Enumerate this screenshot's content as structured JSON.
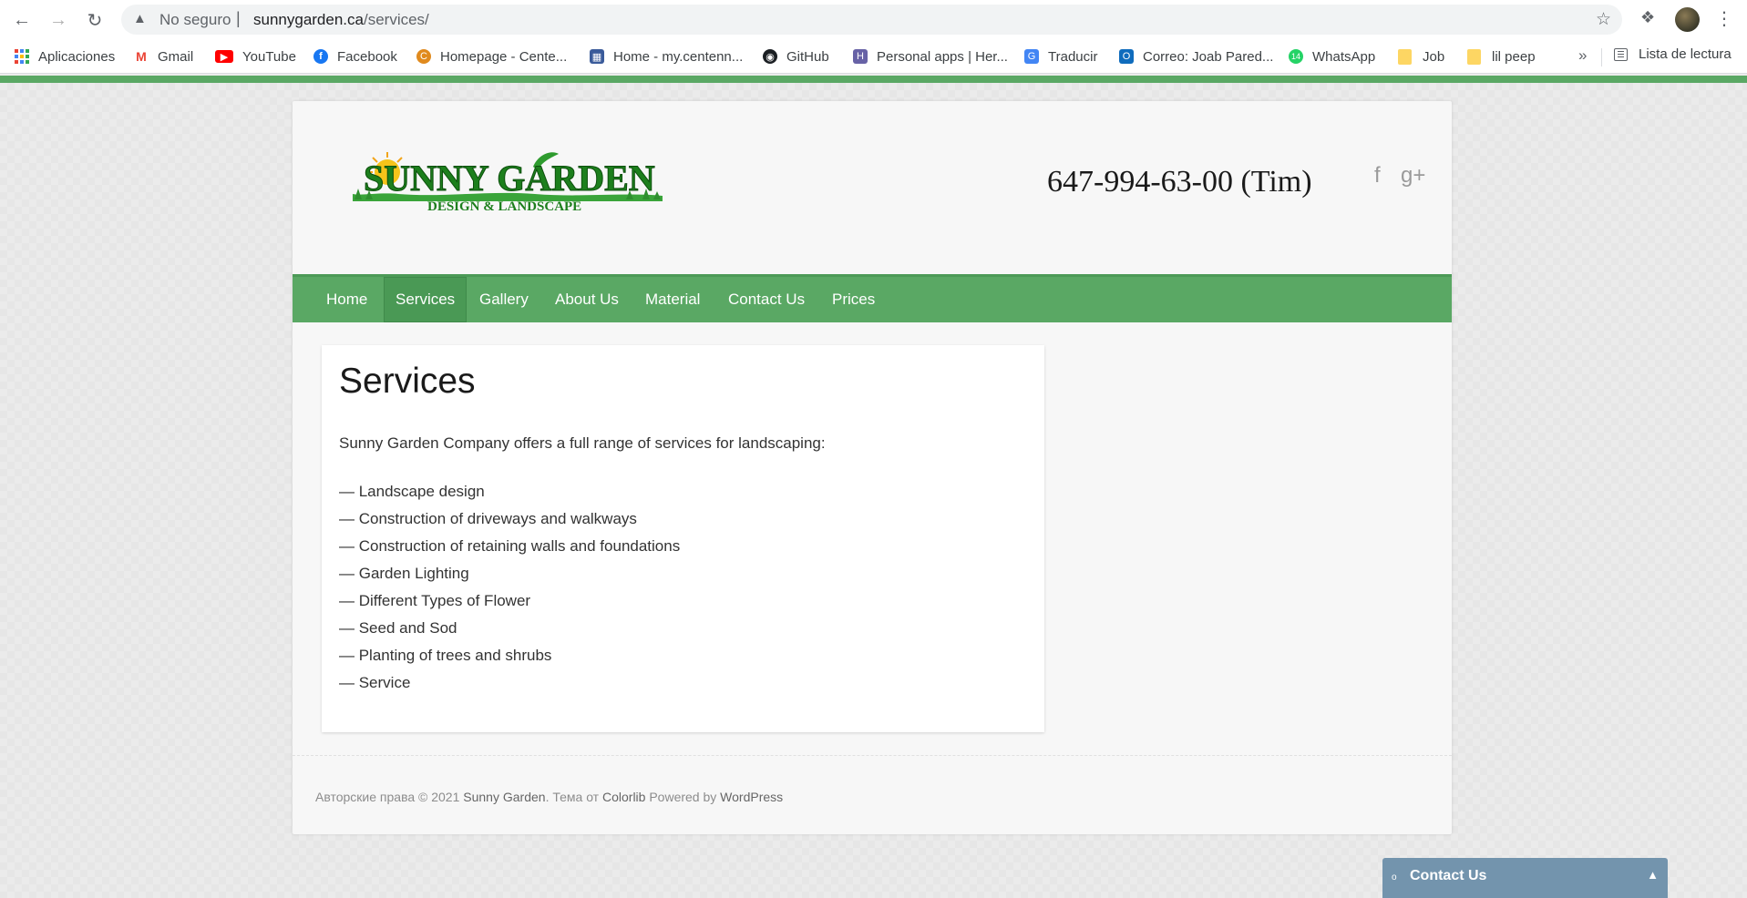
{
  "browser": {
    "insecure_label": "No seguro",
    "separator": "|",
    "url_host": "sunnygarden.ca",
    "url_path": "/services/",
    "bookmarks": [
      {
        "label": "Aplicaciones",
        "icon": "apps-grid-icon"
      },
      {
        "label": "Gmail",
        "icon": "gmail-icon",
        "color": "#ea4335"
      },
      {
        "label": "YouTube",
        "icon": "youtube-icon",
        "color": "#ff0000"
      },
      {
        "label": "Facebook",
        "icon": "facebook-icon",
        "color": "#1877f2"
      },
      {
        "label": "Homepage - Cente...",
        "icon": "centennial-icon",
        "color": "#e08a1e"
      },
      {
        "label": "Home - my.centenn...",
        "icon": "mycentennial-icon",
        "color": "#3a5b9a"
      },
      {
        "label": "GitHub",
        "icon": "github-icon",
        "color": "#1b1f23"
      },
      {
        "label": "Personal apps | Her...",
        "icon": "heroku-icon",
        "color": "#6762a6"
      },
      {
        "label": "Traducir",
        "icon": "translate-icon",
        "color": "#4285f4"
      },
      {
        "label": "Correo: Joab Pared...",
        "icon": "outlook-icon",
        "color": "#0f6cbd"
      },
      {
        "label": "WhatsApp",
        "icon": "whatsapp-icon",
        "color": "#25d366"
      },
      {
        "label": "Job",
        "icon": "folder-icon"
      },
      {
        "label": "lil peep",
        "icon": "folder-icon"
      }
    ],
    "more": "»",
    "reading_list": "Lista de lectura"
  },
  "site": {
    "logo": {
      "main": "SUNNY GARDEN",
      "sub": "DESIGN & LANDSCAPE"
    },
    "phone": "647-994-63-00 (Tim)",
    "social": {
      "facebook": "f",
      "google_plus": "g+"
    },
    "nav": [
      "Home",
      "Services",
      "Gallery",
      "About Us",
      "Material",
      "Contact Us",
      "Prices"
    ],
    "active_nav": "Services",
    "page_title": "Services",
    "intro": "Sunny Garden Company offers a full range of services for landscaping:",
    "services": [
      "— Landscape design",
      "— Construction of driveways and walkways",
      "— Construction of retaining walls and foundations",
      "— Garden Lighting",
      "— Different Types of Flower",
      "— Seed and Sod",
      "— Planting of trees and shrubs",
      "— Service"
    ],
    "footer": {
      "copyright": "Авторские права © 2021 ",
      "site_name": "Sunny Garden",
      "theme_text": ". Тема от ",
      "theme_author": "Colorlib",
      "powered_text": " Powered by ",
      "powered_link": "WordPress"
    }
  },
  "contact_widget": {
    "label": "Contact Us",
    "dot": "o",
    "caret": "▲"
  },
  "colors": {
    "accent_green": "#5aa864",
    "active_nav": "#4a9955",
    "widget_blue": "#7394ad"
  }
}
